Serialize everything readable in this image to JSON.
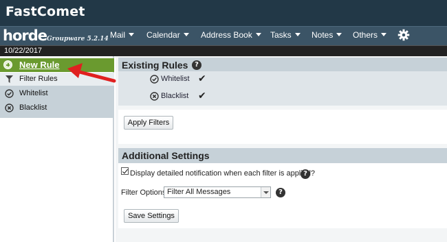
{
  "brand": "FastComet",
  "app": {
    "logo": "horde",
    "subtitle": "Groupware 5.2.14"
  },
  "menu": [
    "Mail",
    "Calendar",
    "Address Book",
    "Tasks",
    "Notes",
    "Others"
  ],
  "date": "10/22/2017",
  "sidebar": {
    "new_rule": "New Rule",
    "items": [
      {
        "label": "Filter Rules",
        "icon": "filter-icon"
      },
      {
        "label": "Whitelist",
        "icon": "check-circle-icon"
      },
      {
        "label": "Blacklist",
        "icon": "x-circle-icon"
      }
    ]
  },
  "existing_rules": {
    "title": "Existing Rules",
    "rules": [
      {
        "name": "Whitelist",
        "icon": "check-circle-icon",
        "enabled": true
      },
      {
        "name": "Blacklist",
        "icon": "x-circle-icon",
        "enabled": true
      }
    ],
    "apply_button": "Apply Filters"
  },
  "additional_settings": {
    "title": "Additional Settings",
    "notification_label": "Display detailed notification when each filter is applied?",
    "notification_checked": true,
    "filter_options_label": "Filter Options",
    "filter_options_value": "Filter All Messages",
    "save_button": "Save Settings"
  },
  "colors": {
    "brand_bar": "#223847",
    "menu_bar": "#3b5466",
    "new_rule_green": "#6a9a2f",
    "annotation_arrow": "#e02020"
  }
}
